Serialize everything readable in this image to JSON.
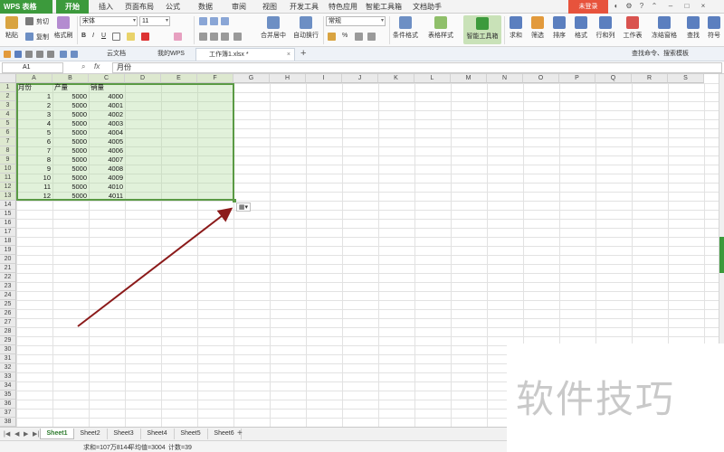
{
  "app": {
    "name": "WPS 表格"
  },
  "menu_tabs": [
    "开始",
    "插入",
    "页面布局",
    "公式",
    "数据",
    "审阅",
    "视图",
    "开发工具",
    "特色应用",
    "智能工具箱",
    "文档助手"
  ],
  "login_label": "未登录",
  "ribbon": {
    "paste": "粘贴",
    "cut": "剪切",
    "copy": "复制",
    "format_painter": "格式刷",
    "font_name": "宋体",
    "font_size": "11",
    "bold": "B",
    "italic": "I",
    "underline": "U",
    "merge_center": "合并居中",
    "wrap_text": "自动换行",
    "number_format": "常规",
    "percent": "%",
    "conditional_format": "条件格式",
    "table_style": "表格样式",
    "smart_toolbox": "智能工具箱",
    "sum": "求和",
    "filter": "筛选",
    "sort": "排序",
    "format": "格式",
    "rows_cols": "行和列",
    "worksheet": "工作表",
    "freeze": "冻结窗格",
    "find": "查找",
    "symbol": "符号"
  },
  "doc_tabs": {
    "cloud": "云文档",
    "my_wps": "我的WPS",
    "workbook": "工作簿1.xlsx *"
  },
  "find_command": "查找命令、搜索模板",
  "formula_bar": {
    "name_box": "A1",
    "fx": "fx",
    "content": "月份"
  },
  "columns": [
    "A",
    "B",
    "C",
    "D",
    "E",
    "F",
    "G",
    "H",
    "I",
    "J",
    "K",
    "L",
    "M",
    "N",
    "O",
    "P",
    "Q",
    "R",
    "S"
  ],
  "row_count": 38,
  "table": {
    "headers": [
      "月份",
      "产量",
      "销量"
    ],
    "rows": [
      [
        1,
        5000,
        4000
      ],
      [
        2,
        5000,
        4001
      ],
      [
        3,
        5000,
        4002
      ],
      [
        4,
        5000,
        4003
      ],
      [
        5,
        5000,
        4004
      ],
      [
        6,
        5000,
        4005
      ],
      [
        7,
        5000,
        4006
      ],
      [
        8,
        5000,
        4007
      ],
      [
        9,
        5000,
        4008
      ],
      [
        10,
        5000,
        4009
      ],
      [
        11,
        5000,
        4010
      ],
      [
        12,
        5000,
        4011
      ]
    ]
  },
  "sheets": [
    "Sheet1",
    "Sheet2",
    "Sheet3",
    "Sheet4",
    "Sheet5",
    "Sheet6"
  ],
  "status": {
    "sum": "求和=107万8144",
    "average": "平均值=3004",
    "count": "计数=39"
  },
  "watermark": "软件技巧",
  "colors": {
    "accent": "#3c9a3c",
    "selection_border": "#5a9a44",
    "arrow": "#8b1a1a",
    "login": "#e7533c"
  }
}
